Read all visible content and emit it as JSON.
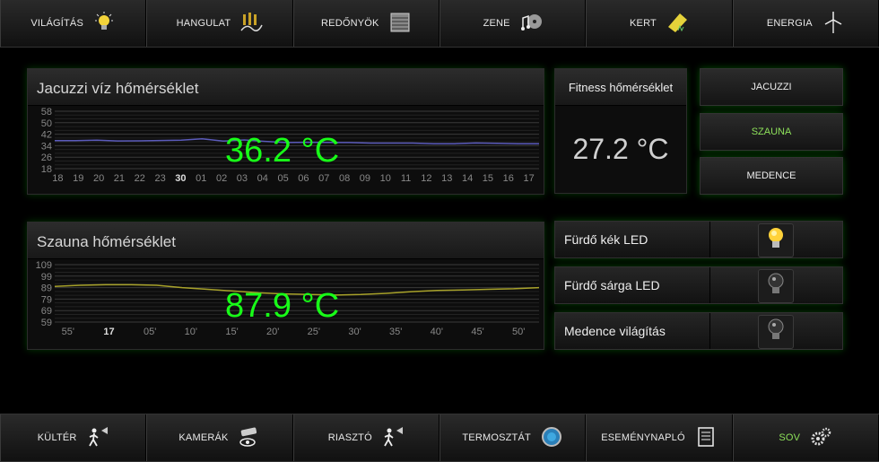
{
  "top_nav": [
    {
      "label": "VILÁGÍTÁS",
      "icon": "bulb-icon"
    },
    {
      "label": "HANGULAT",
      "icon": "mood-icon"
    },
    {
      "label": "REDŐNYÖK",
      "icon": "blinds-icon"
    },
    {
      "label": "ZENE",
      "icon": "music-icon"
    },
    {
      "label": "KERT",
      "icon": "garden-icon"
    },
    {
      "label": "ENERGIA",
      "icon": "wind-turbine-icon"
    }
  ],
  "bottom_nav": [
    {
      "label": "KÜLTÉR",
      "icon": "motion-sensor-icon"
    },
    {
      "label": "KAMERÁK",
      "icon": "camera-icon"
    },
    {
      "label": "RIASZTÓ",
      "icon": "alarm-icon"
    },
    {
      "label": "TERMOSZTÁT",
      "icon": "thermostat-icon"
    },
    {
      "label": "ESEMÉNYNAPLÓ",
      "icon": "log-icon"
    },
    {
      "label": "SOV",
      "icon": "gears-icon",
      "active": true
    }
  ],
  "jacuzzi": {
    "title": "Jacuzzi víz hőmérséklet",
    "value": "36.2 °C"
  },
  "sauna": {
    "title": "Szauna hőmérséklet",
    "value": "87.9 °C"
  },
  "fitness": {
    "title": "Fitness hőmérséklet",
    "value": "27.2 °C"
  },
  "side_buttons": [
    {
      "label": "JACUZZI",
      "active": false
    },
    {
      "label": "SZAUNA",
      "active": true
    },
    {
      "label": "MEDENCE",
      "active": false
    }
  ],
  "lights": [
    {
      "label": "Fürdő kék LED",
      "on": true
    },
    {
      "label": "Fürdő sárga LED",
      "on": false
    },
    {
      "label": "Medence világítás",
      "on": false
    }
  ],
  "colors": {
    "accent": "#18ff18",
    "active_text": "#8de05a",
    "jacuzzi_line": "#5b5bbb",
    "sauna_line": "#a8a22a"
  },
  "chart_data": [
    {
      "type": "line",
      "title": "Jacuzzi víz hőmérséklet",
      "yticks": [
        "58",
        "50",
        "42",
        "34",
        "26",
        "18"
      ],
      "ylim": [
        18,
        58
      ],
      "xticks": [
        "18",
        "19",
        "20",
        "21",
        "22",
        "23",
        "30",
        "01",
        "02",
        "03",
        "04",
        "05",
        "06",
        "07",
        "08",
        "09",
        "10",
        "11",
        "12",
        "13",
        "14",
        "15",
        "16",
        "17"
      ],
      "bold_tick": "30",
      "series": [
        {
          "values": [
            37.5,
            37.5,
            37.8,
            37.3,
            37.4,
            37.6,
            37.8,
            38.8,
            37.2,
            38,
            37,
            36.2,
            36.4,
            36.3,
            36.2,
            35.8,
            35.8,
            35.8,
            35.4,
            35.4,
            35.9,
            35.6,
            35.4,
            35.3
          ]
        }
      ]
    },
    {
      "type": "line",
      "title": "Szauna hőmérséklet",
      "yticks": [
        "109",
        "99",
        "89",
        "79",
        "69",
        "59"
      ],
      "ylim": [
        59,
        109
      ],
      "xticks": [
        "55'",
        "17",
        "05'",
        "10'",
        "15'",
        "20'",
        "25'",
        "30'",
        "35'",
        "40'",
        "45'",
        "50'"
      ],
      "bold_tick": "17",
      "series": [
        {
          "values": [
            90,
            91,
            91.5,
            91.5,
            91,
            89,
            87.5,
            86,
            84.5,
            83.5,
            83,
            82.5,
            83,
            84,
            85.5,
            86.5,
            87,
            87.5,
            88,
            89
          ]
        }
      ]
    }
  ]
}
